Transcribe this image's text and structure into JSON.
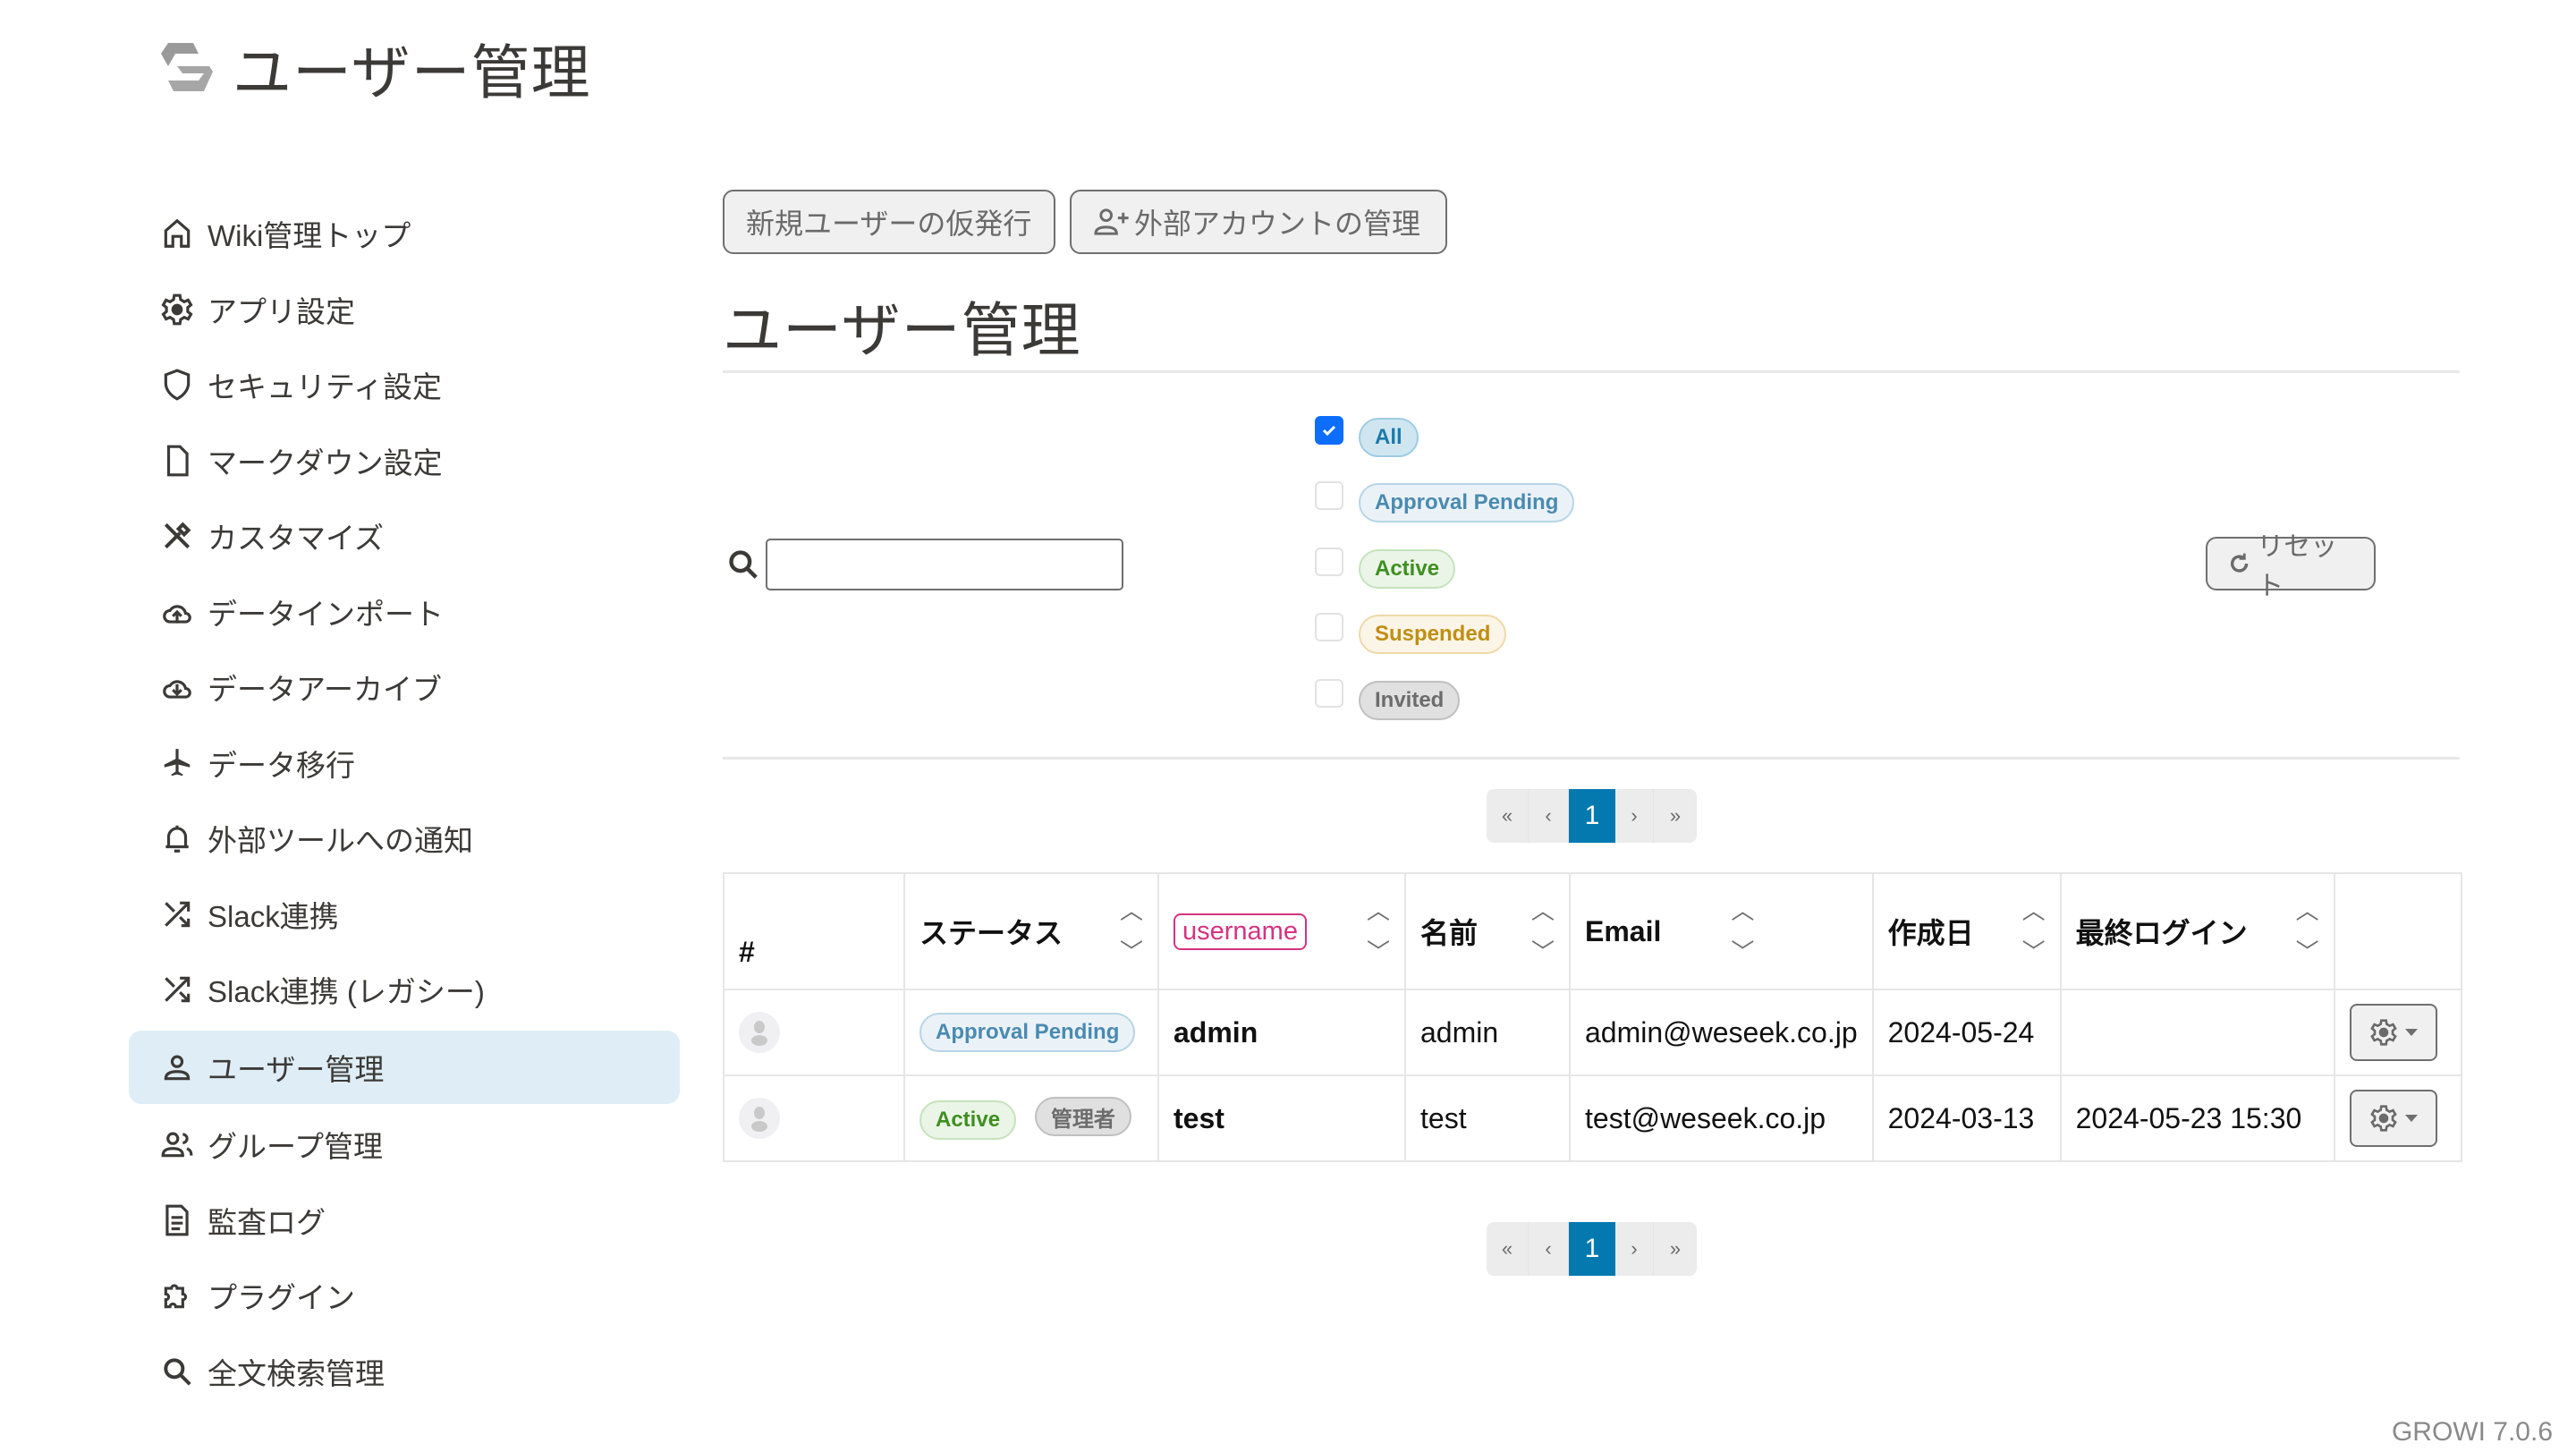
{
  "brand": {
    "title": "ユーザー管理",
    "logo": "growi-logo"
  },
  "sidebar": {
    "items": [
      {
        "label": "Wiki管理トップ",
        "icon": "home-icon"
      },
      {
        "label": "アプリ設定",
        "icon": "gear-icon"
      },
      {
        "label": "セキュリティ設定",
        "icon": "shield-icon"
      },
      {
        "label": "マークダウン設定",
        "icon": "file-icon"
      },
      {
        "label": "カスタマイズ",
        "icon": "tools-icon"
      },
      {
        "label": "データインポート",
        "icon": "cloud-upload-icon"
      },
      {
        "label": "データアーカイブ",
        "icon": "cloud-download-icon"
      },
      {
        "label": "データ移行",
        "icon": "airplane-icon"
      },
      {
        "label": "外部ツールへの通知",
        "icon": "bell-icon"
      },
      {
        "label": "Slack連携",
        "icon": "shuffle-icon"
      },
      {
        "label": "Slack連携 (レガシー)",
        "icon": "shuffle-icon"
      },
      {
        "label": "ユーザー管理",
        "icon": "person-icon",
        "active": true
      },
      {
        "label": "グループ管理",
        "icon": "group-icon"
      },
      {
        "label": "監査ログ",
        "icon": "document-icon"
      },
      {
        "label": "プラグイン",
        "icon": "puzzle-icon"
      },
      {
        "label": "全文検索管理",
        "icon": "search-icon"
      }
    ]
  },
  "toolbar": {
    "new_user_label": "新規ユーザーの仮発行",
    "external_accounts_label": "外部アカウントの管理"
  },
  "main": {
    "title": "ユーザー管理",
    "search": {
      "value": "",
      "placeholder": ""
    },
    "filters": [
      {
        "label": "All",
        "checked": true
      },
      {
        "label": "Approval Pending",
        "checked": false
      },
      {
        "label": "Active",
        "checked": false
      },
      {
        "label": "Suspended",
        "checked": false
      },
      {
        "label": "Invited",
        "checked": false
      }
    ],
    "reset_label": "リセット",
    "pagination": {
      "first": "«",
      "prev": "‹",
      "current": "1",
      "next": "›",
      "last": "»"
    },
    "table": {
      "columns": [
        "#",
        "ステータス",
        "username",
        "名前",
        "Email",
        "作成日",
        "最終ログイン",
        ""
      ],
      "sort_up": "^",
      "sort_down": "v",
      "rows": [
        {
          "status": [
            "Approval Pending"
          ],
          "username": "admin",
          "name": "admin",
          "email": "admin@weseek.co.jp",
          "created": "2024-05-24",
          "last_login": ""
        },
        {
          "status": [
            "Active",
            "管理者"
          ],
          "username": "test",
          "name": "test",
          "email": "test@weseek.co.jp",
          "created": "2024-03-13",
          "last_login": "2024-05-23 15:30"
        }
      ]
    }
  },
  "footer": {
    "version": "GROWI 7.0.6"
  },
  "colors": {
    "accent": "#0379b0",
    "active_nav_bg": "#dfedf6",
    "checkbox": "#0d6efd",
    "username_badge": "#d6327f"
  }
}
